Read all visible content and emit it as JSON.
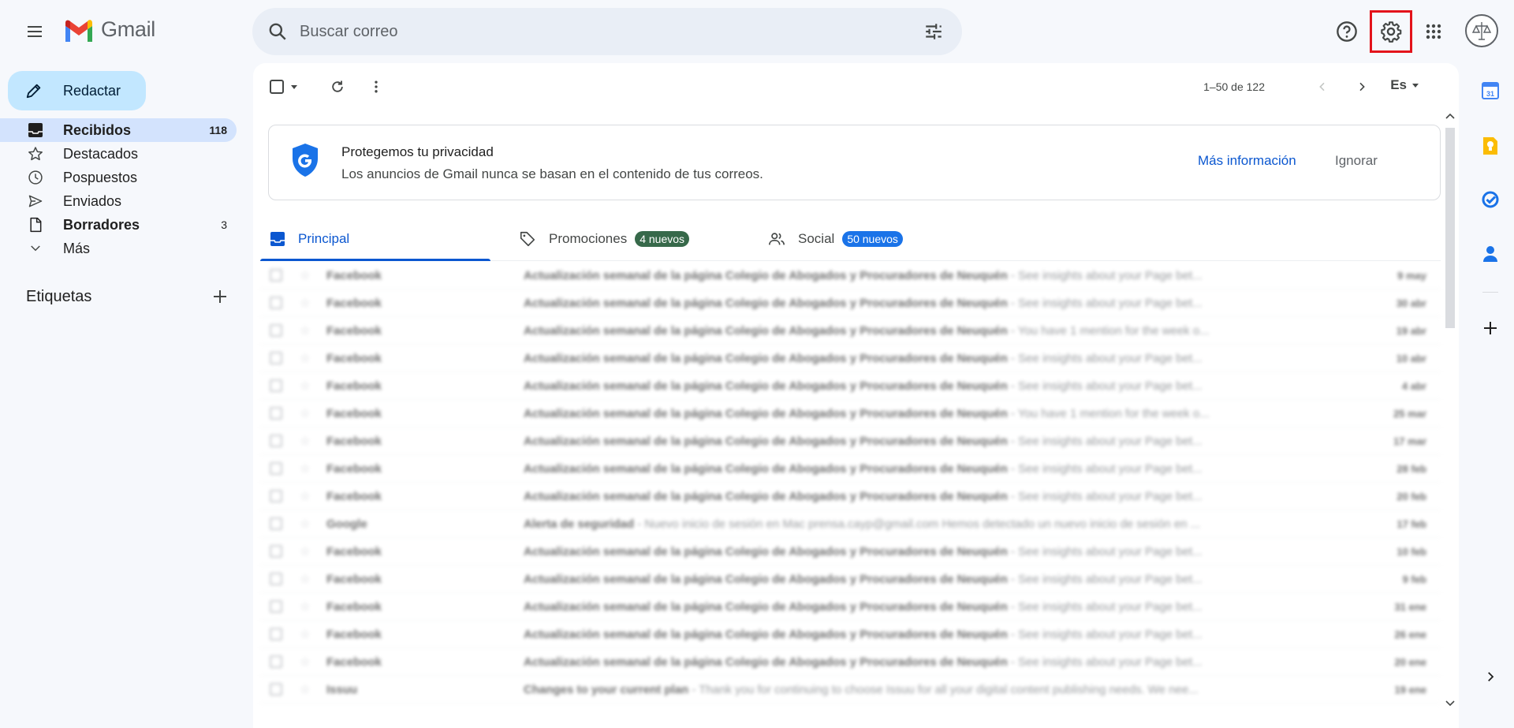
{
  "app": {
    "logo_text": "Gmail"
  },
  "search": {
    "placeholder": "Buscar correo"
  },
  "sidebar": {
    "compose_label": "Redactar",
    "items": [
      {
        "label": "Recibidos",
        "count": "118",
        "icon": "inbox-icon",
        "active": true,
        "bold": true
      },
      {
        "label": "Destacados",
        "count": "",
        "icon": "star-icon",
        "active": false,
        "bold": false
      },
      {
        "label": "Pospuestos",
        "count": "",
        "icon": "clock-icon",
        "active": false,
        "bold": false
      },
      {
        "label": "Enviados",
        "count": "",
        "icon": "send-icon",
        "active": false,
        "bold": false
      },
      {
        "label": "Borradores",
        "count": "3",
        "icon": "draft-icon",
        "active": false,
        "bold": true
      },
      {
        "label": "Más",
        "count": "",
        "icon": "chevron-down-icon",
        "active": false,
        "bold": false
      }
    ],
    "labels_title": "Etiquetas"
  },
  "toolbar": {
    "pagination": "1–50 de 122",
    "language": "Es"
  },
  "privacy_banner": {
    "title": "Protegemos tu privacidad",
    "text": "Los anuncios de Gmail nunca se basan en el contenido de tus correos.",
    "more_label": "Más información",
    "ignore_label": "Ignorar"
  },
  "tabs": [
    {
      "label": "Principal",
      "badge": "",
      "active": true
    },
    {
      "label": "Promociones",
      "badge": "4 nuevos",
      "badge_color": "#37694a",
      "active": false
    },
    {
      "label": "Social",
      "badge": "50 nuevos",
      "badge_color": "#1a73e8",
      "active": false
    }
  ],
  "emails": [
    {
      "sender": "Facebook",
      "subject": "Actualización semanal de la página Colegio de Abogados y Procuradores de Neuquén",
      "snippet": "See insights about your Page bet...",
      "date": "9 may"
    },
    {
      "sender": "Facebook",
      "subject": "Actualización semanal de la página Colegio de Abogados y Procuradores de Neuquén",
      "snippet": "See insights about your Page bet...",
      "date": "30 abr"
    },
    {
      "sender": "Facebook",
      "subject": "Actualización semanal de la página Colegio de Abogados y Procuradores de Neuquén",
      "snippet": "You have 1 mention for the week o...",
      "date": "19 abr"
    },
    {
      "sender": "Facebook",
      "subject": "Actualización semanal de la página Colegio de Abogados y Procuradores de Neuquén",
      "snippet": "See insights about your Page bet...",
      "date": "10 abr"
    },
    {
      "sender": "Facebook",
      "subject": "Actualización semanal de la página Colegio de Abogados y Procuradores de Neuquén",
      "snippet": "See insights about your Page bet...",
      "date": "4 abr"
    },
    {
      "sender": "Facebook",
      "subject": "Actualización semanal de la página Colegio de Abogados y Procuradores de Neuquén",
      "snippet": "You have 1 mention for the week o...",
      "date": "25 mar"
    },
    {
      "sender": "Facebook",
      "subject": "Actualización semanal de la página Colegio de Abogados y Procuradores de Neuquén",
      "snippet": "See insights about your Page bet...",
      "date": "17 mar"
    },
    {
      "sender": "Facebook",
      "subject": "Actualización semanal de la página Colegio de Abogados y Procuradores de Neuquén",
      "snippet": "See insights about your Page bet...",
      "date": "28 feb"
    },
    {
      "sender": "Facebook",
      "subject": "Actualización semanal de la página Colegio de Abogados y Procuradores de Neuquén",
      "snippet": "See insights about your Page bet...",
      "date": "20 feb"
    },
    {
      "sender": "Google",
      "subject": "Alerta de seguridad",
      "snippet": "Nuevo inicio de sesión en Mac prensa.cayp@gmail.com Hemos detectado un nuevo inicio de sesión en ...",
      "date": "17 feb"
    },
    {
      "sender": "Facebook",
      "subject": "Actualización semanal de la página Colegio de Abogados y Procuradores de Neuquén",
      "snippet": "See insights about your Page bet...",
      "date": "10 feb"
    },
    {
      "sender": "Facebook",
      "subject": "Actualización semanal de la página Colegio de Abogados y Procuradores de Neuquén",
      "snippet": "See insights about your Page bet...",
      "date": "9 feb"
    },
    {
      "sender": "Facebook",
      "subject": "Actualización semanal de la página Colegio de Abogados y Procuradores de Neuquén",
      "snippet": "See insights about your Page bet...",
      "date": "31 ene"
    },
    {
      "sender": "Facebook",
      "subject": "Actualización semanal de la página Colegio de Abogados y Procuradores de Neuquén",
      "snippet": "See insights about your Page bet...",
      "date": "26 ene"
    },
    {
      "sender": "Facebook",
      "subject": "Actualización semanal de la página Colegio de Abogados y Procuradores de Neuquén",
      "snippet": "See insights about your Page bet...",
      "date": "20 ene"
    },
    {
      "sender": "Issuu",
      "subject": "Changes to your current plan",
      "snippet": "Thank you for continuing to choose Issuu for all your digital content publishing needs. We nee...",
      "date": "19 ene"
    }
  ],
  "colors": {
    "accent": "#0b57d0",
    "compose_bg": "#c2e7ff",
    "active_nav_bg": "#d3e3fd",
    "highlight_border": "#e3131b"
  }
}
